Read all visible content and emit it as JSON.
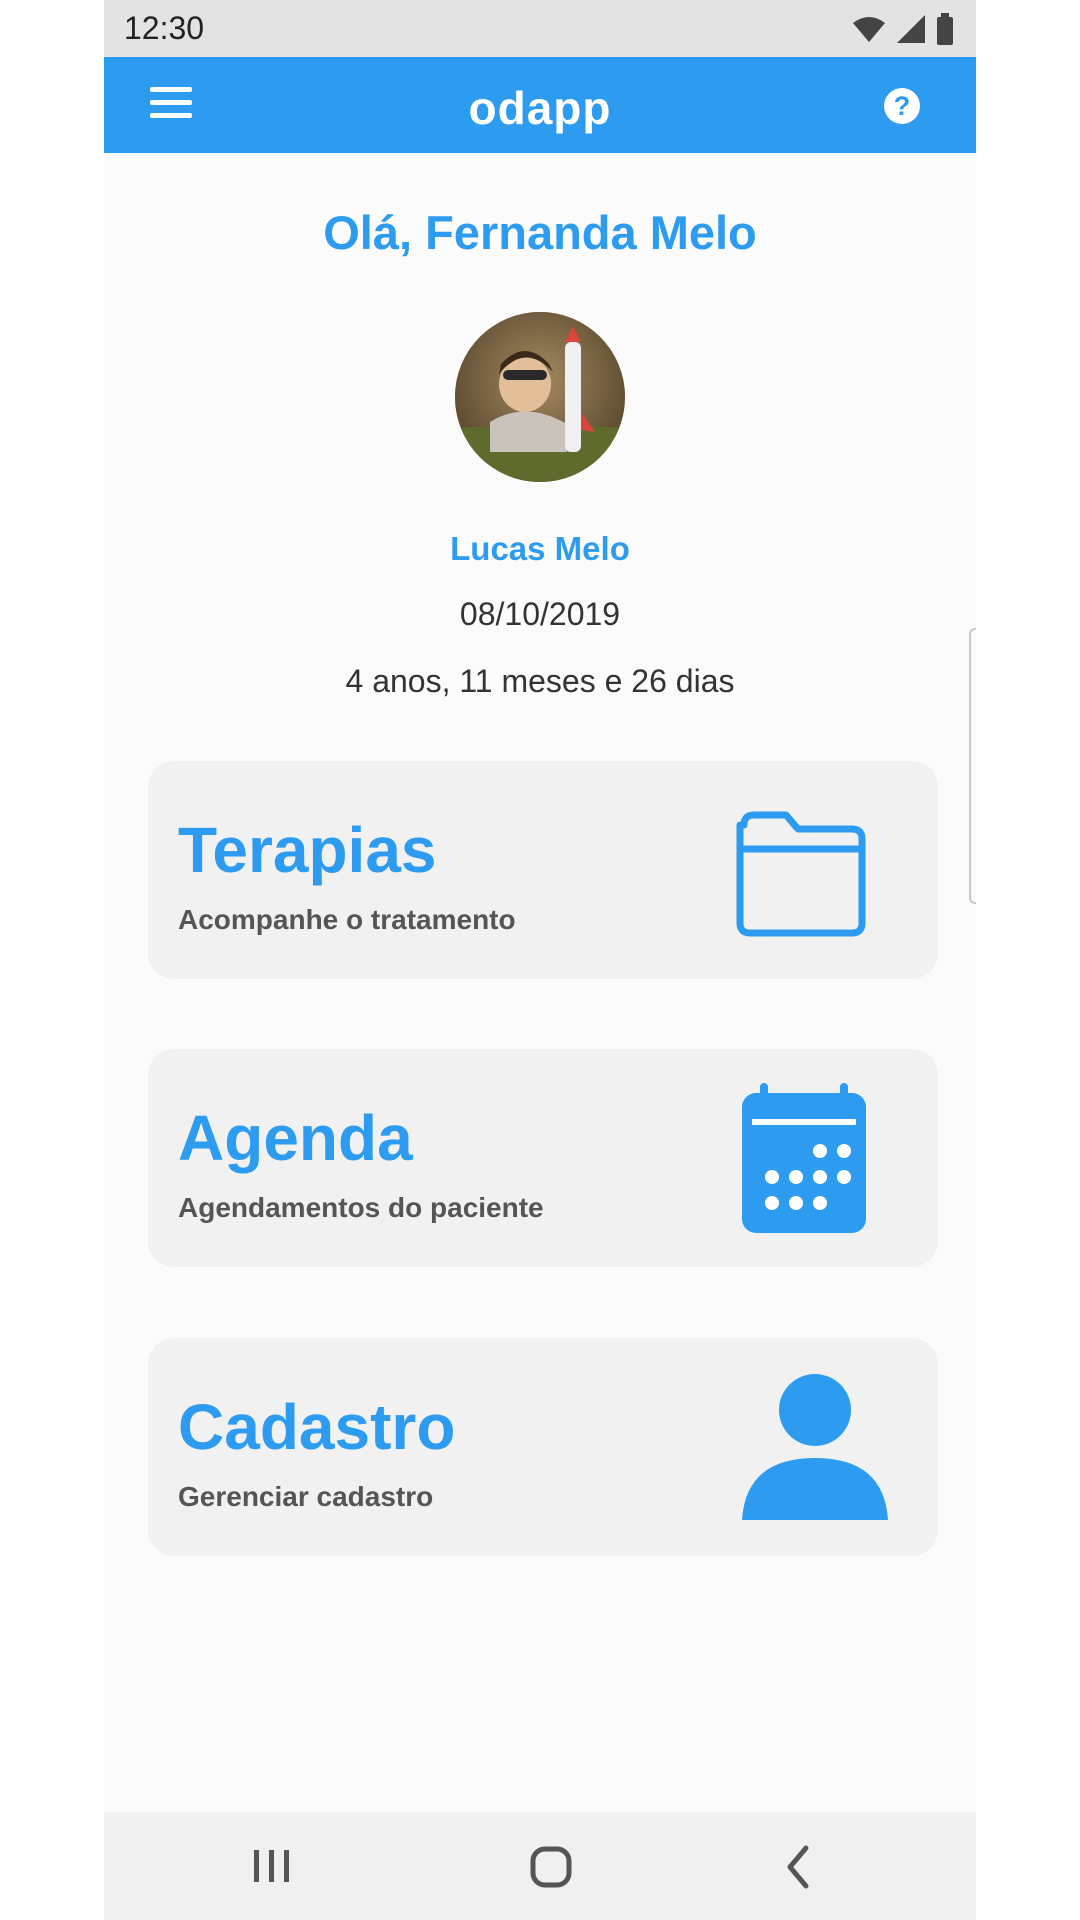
{
  "status_bar": {
    "time": "12:30",
    "icons": [
      "wifi-icon",
      "signal-icon",
      "battery-icon"
    ]
  },
  "app_bar": {
    "title": "odapp",
    "menu_icon": "menu-icon",
    "help_label": "?"
  },
  "greeting": "Olá, Fernanda Melo",
  "patient": {
    "name": "Lucas Melo",
    "birth_date": "08/10/2019",
    "age": "4 anos, 11 meses e 26 dias"
  },
  "cards": [
    {
      "title": "Terapias",
      "subtitle": "Acompanhe o tratamento",
      "icon": "folder-icon"
    },
    {
      "title": "Agenda",
      "subtitle": "Agendamentos do paciente",
      "icon": "calendar-icon"
    },
    {
      "title": "Cadastro",
      "subtitle": "Gerenciar cadastro",
      "icon": "person-icon"
    }
  ],
  "nav_bar": {
    "icons": [
      "recent-apps-icon",
      "home-icon",
      "back-icon"
    ]
  },
  "colors": {
    "primary": "#2d9bef",
    "card_bg": "#f1f1f1",
    "text": "#333333"
  }
}
